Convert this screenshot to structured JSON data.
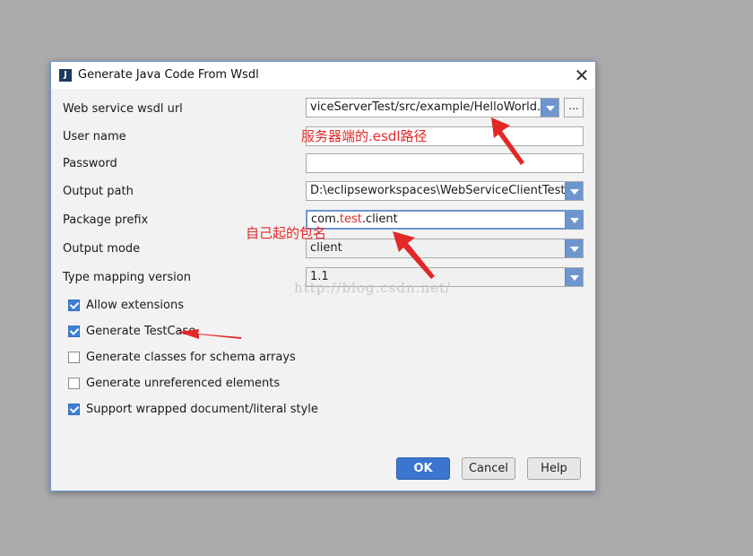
{
  "dialog": {
    "title": "Generate Java Code From Wsdl",
    "icon": "intellij-icon",
    "close_glyph": "✕"
  },
  "form": {
    "wsdl_url": {
      "label": "Web service wsdl url",
      "value": "viceServerTest/src/example/HelloWorld.wsdl",
      "browse_label": "..."
    },
    "user_name": {
      "label": "User name",
      "value": ""
    },
    "password": {
      "label": "Password",
      "value": ""
    },
    "output_path": {
      "label": "Output path",
      "value": "D:\\eclipseworkspaces\\WebServiceClientTest\\src"
    },
    "package_prefix": {
      "label": "Package prefix",
      "value_prefix": "com.",
      "value_highlight": "test",
      "value_suffix": ".client"
    },
    "output_mode": {
      "label": "Output mode",
      "value": "client"
    },
    "type_mapping_version": {
      "label": "Type mapping version",
      "value": "1.1"
    }
  },
  "checkboxes": [
    {
      "label": "Allow extensions",
      "checked": true
    },
    {
      "label": "Generate TestCase",
      "checked": true
    },
    {
      "label": "Generate classes for schema arrays",
      "checked": false
    },
    {
      "label": "Generate unreferenced elements",
      "checked": false
    },
    {
      "label": "Support wrapped document/literal style",
      "checked": true
    }
  ],
  "buttons": {
    "ok": "OK",
    "cancel": "Cancel",
    "help": "Help"
  },
  "annotations": {
    "esdl_path": "服务器端的.esdl路径",
    "package_name": "自己起的包名"
  },
  "watermark": "http://blog.csdn.net/",
  "colors": {
    "accent": "#3b75cf",
    "annotation": "#e32828"
  }
}
